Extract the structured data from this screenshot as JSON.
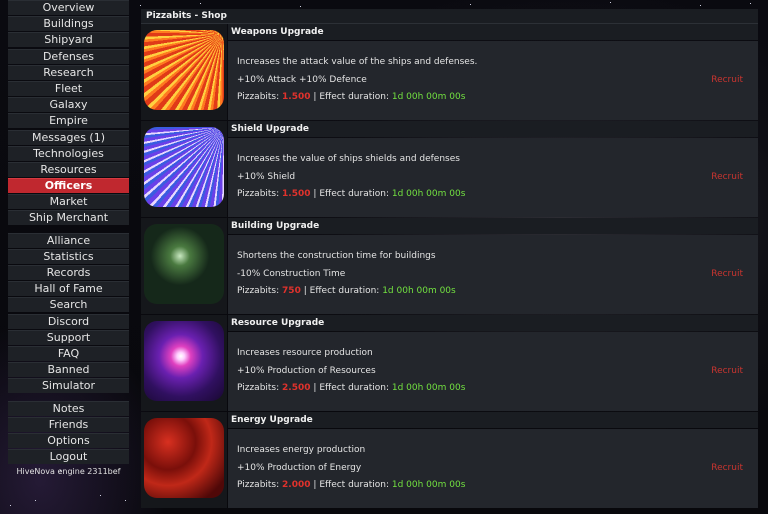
{
  "sidebar": {
    "groups": [
      [
        "Overview",
        "Buildings",
        "Shipyard",
        "Defenses",
        "Research",
        "Fleet",
        "Galaxy",
        "Empire",
        "Messages (1)",
        "Technologies",
        "Resources",
        "Officers",
        "Market",
        "Ship Merchant"
      ],
      [
        "Alliance",
        "Statistics",
        "Records",
        "Hall of Fame",
        "Search",
        "Discord",
        "Support",
        "FAQ",
        "Banned",
        "Simulator"
      ],
      [
        "Notes",
        "Friends",
        "Options",
        "Logout"
      ]
    ],
    "active": "Officers",
    "engine": "HiveNova engine 2311bef"
  },
  "shop": {
    "title": "Pizzabits - Shop",
    "currency_label": "Pizzabits:",
    "duration_label": "Effect duration:",
    "separator": "|",
    "action_label": "Recruit",
    "items": [
      {
        "name": "Weapons Upgrade",
        "description": "Increases the attack value of the ships and defenses.",
        "effect": "+10% Attack +10% Defence",
        "cost": "1.500",
        "duration": "1d 00h 00m 00s",
        "image_icon": "weapons-burst-icon"
      },
      {
        "name": "Shield Upgrade",
        "description": "Increases the value of ships shields and defenses",
        "effect": "+10% Shield",
        "cost": "1.500",
        "duration": "1d 00h 00m 00s",
        "image_icon": "shield-burst-icon"
      },
      {
        "name": "Building Upgrade",
        "description": "Shortens the construction time for buildings",
        "effect": "-10% Construction Time",
        "cost": "750",
        "duration": "1d 00h 00m 00s",
        "image_icon": "building-vines-icon"
      },
      {
        "name": "Resource Upgrade",
        "description": "Increases resource production",
        "effect": "+10% Production of Resources",
        "cost": "2.500",
        "duration": "1d 00h 00m 00s",
        "image_icon": "resource-nebula-icon"
      },
      {
        "name": "Energy Upgrade",
        "description": "Increases energy production",
        "effect": "+10% Production of Energy",
        "cost": "2.000",
        "duration": "1d 00h 00m 00s",
        "image_icon": "energy-flame-icon"
      }
    ]
  },
  "colors": {
    "accent": "#c0282f",
    "cost": "#e0322c",
    "duration": "#72e040",
    "recruit": "#c83530"
  }
}
